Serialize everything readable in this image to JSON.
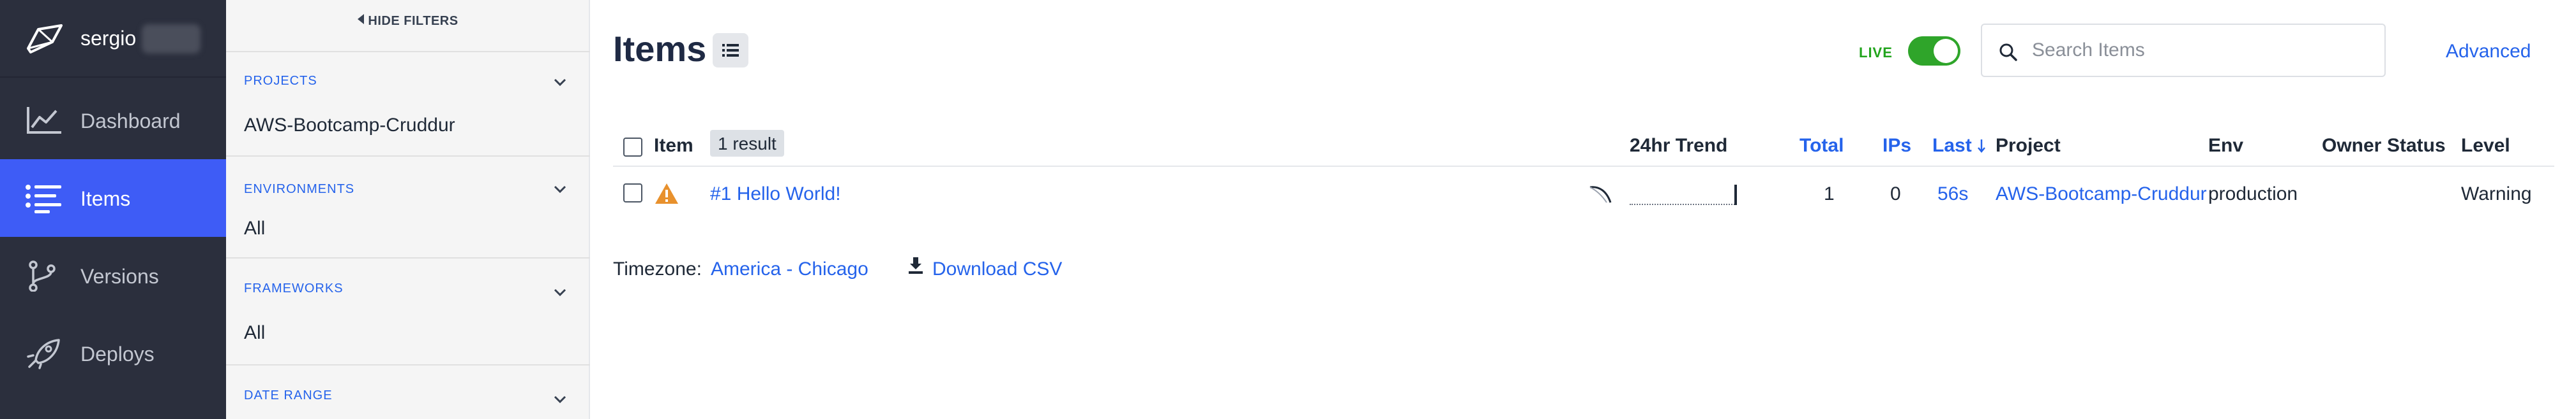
{
  "nav": {
    "username": "sergio",
    "items": [
      {
        "label": "Dashboard",
        "icon": "chart-line-icon"
      },
      {
        "label": "Items",
        "icon": "list-icon",
        "active": true
      },
      {
        "label": "Versions",
        "icon": "git-branch-icon"
      },
      {
        "label": "Deploys",
        "icon": "rocket-icon"
      }
    ]
  },
  "filters": {
    "hide_label": "HIDE FILTERS",
    "sections": [
      {
        "heading": "PROJECTS",
        "value": "AWS-Bootcamp-Cruddur"
      },
      {
        "heading": "ENVIRONMENTS",
        "value": "All"
      },
      {
        "heading": "FRAMEWORKS",
        "value": "All"
      },
      {
        "heading": "DATE RANGE",
        "value": ""
      }
    ]
  },
  "header": {
    "title": "Items",
    "live_label": "LIVE",
    "live_on": true,
    "search_placeholder": "Search Items",
    "advanced_label": "Advanced"
  },
  "table": {
    "columns": {
      "item": "Item",
      "trend": "24hr Trend",
      "total": "Total",
      "ips": "IPs",
      "last": "Last",
      "project": "Project",
      "env": "Env",
      "owner": "Owner",
      "status": "Status",
      "level": "Level"
    },
    "result_count": "1 result",
    "rows": [
      {
        "title": "#1 Hello World!",
        "total": "1",
        "ips": "0",
        "last": "56s",
        "project": "AWS-Bootcamp-Cruddur",
        "env": "production",
        "owner": "",
        "status": "",
        "level": "Warning"
      }
    ]
  },
  "footer": {
    "timezone_label": "Timezone:",
    "timezone_value": "America - Chicago",
    "download_label": "Download CSV"
  },
  "colors": {
    "nav_bg": "#2b2f3d",
    "nav_active": "#3e5cf6",
    "link": "#2563eb",
    "live_green": "#2fa52a",
    "warning": "#e8912d"
  }
}
